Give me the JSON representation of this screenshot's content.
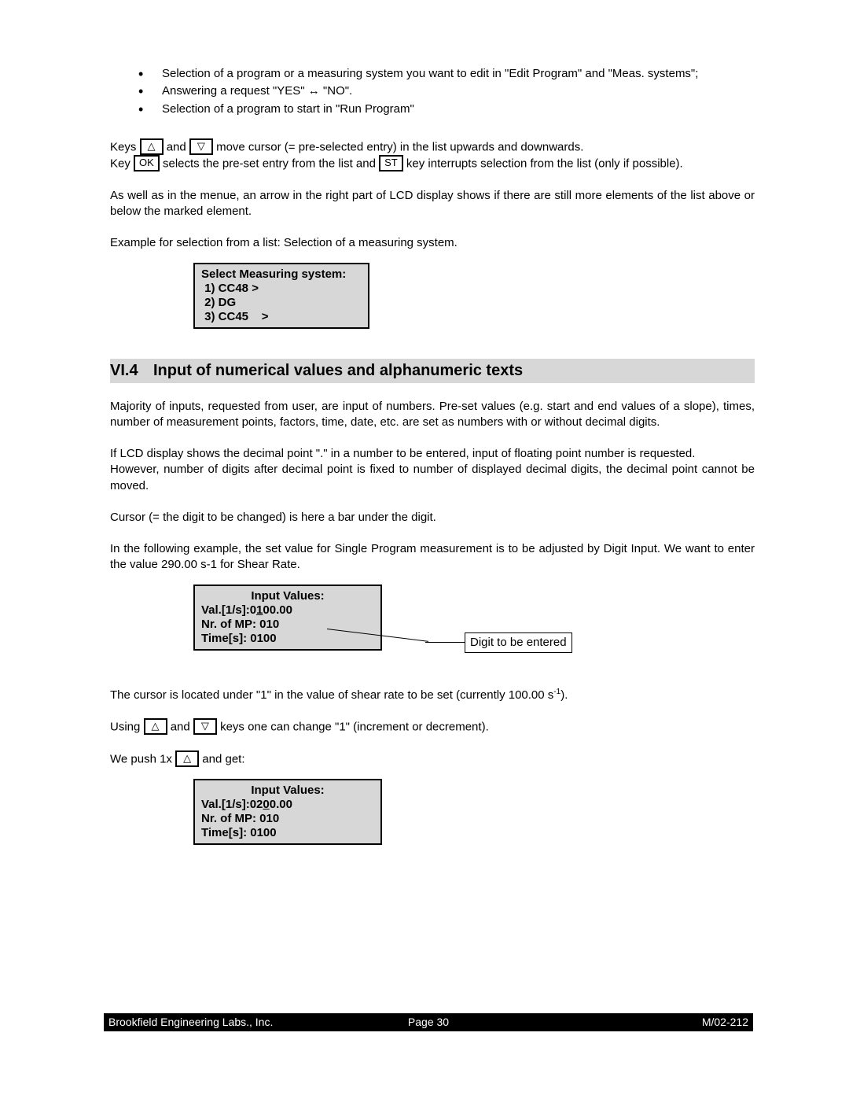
{
  "bullets": {
    "b1": "Selection of a program or a measuring system you want to edit in \"Edit Program\" and \"Meas. systems\";",
    "b2": "Answering a request \"YES\" ↔ \"NO\".",
    "b3": "Selection of a program to start in \"Run Program\""
  },
  "keys": {
    "up": "△",
    "down": "▽",
    "ok": "OK",
    "st": "ST"
  },
  "p_keys_1a": "Keys",
  "p_keys_1b": " and ",
  "p_keys_1c": " move cursor (= pre-selected entry) in the list upwards and downwards.",
  "p_keys_2a": "Key ",
  "p_keys_2b": " selects the pre-set entry from the list and ",
  "p_keys_2c": " key interrupts selection from the list (only if possible).",
  "p_arrow": "As well as in the menue, an arrow in the right part of LCD display shows if there are still more elements of the list above or below the marked element.",
  "p_example_intro": "Example for selection from a list: Selection of a measuring system.",
  "lcd1": {
    "l1": "Select Measuring system:",
    "l2": " 1) CC48 >",
    "l3": " 2) DG",
    "l4": " 3) CC45    >"
  },
  "heading_num": "VI.4",
  "heading_text": "Input of numerical values and alphanumeric texts",
  "p_majority": "Majority of inputs, requested from user, are input of numbers. Pre-set values (e.g. start and end values of a slope), times, number of measurement points, factors, time, date, etc. are set as numbers with or without decimal digits.",
  "p_decimal": "If LCD display shows the decimal point \".\" in a number to be entered, input of floating point number is requested.",
  "p_however": "However, number of digits after decimal point is fixed to number of displayed decimal digits, the decimal point cannot be moved.",
  "p_cursor": "Cursor (= the digit to be changed) is here a bar under the digit.",
  "p_following": "In the following example, the set value for Single Program measurement is to be adjusted by Digit Input. We want to enter the value 290.00 s-1 for Shear Rate.",
  "lcd2": {
    "title": "Input Values:",
    "row1a": "Val.[1/s]:0",
    "row1_digit": "1",
    "row1b": "00.00",
    "row2": "Nr. of MP: 010",
    "row3": "Time[s]: 0100"
  },
  "callout": "Digit to be entered",
  "p_cursor_located_a": "The cursor is located under \"1\" in the value of shear rate to be set (currently 100.00 s",
  "p_cursor_located_b": ").",
  "p_using_a": "Using",
  "p_using_b": " and ",
  "p_using_c": " keys one can change \"1\" (increment or decrement).",
  "p_push_a": "We push 1x ",
  "p_push_b": " and get:",
  "lcd3": {
    "title": "Input Values:",
    "row1a": "Val.[1/s]:02",
    "row1_digit": "0",
    "row1b": "0.00",
    "row2": "Nr. of MP: 010",
    "row3": "Time[s]: 0100"
  },
  "footer": {
    "left": "Brookfield Engineering Labs., Inc.",
    "center": "Page 30",
    "right": "M/02-212"
  }
}
